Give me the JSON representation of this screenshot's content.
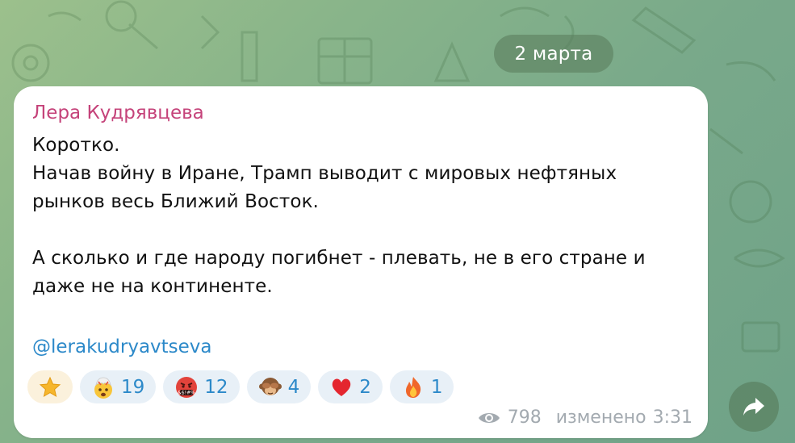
{
  "chat": {
    "date_label": "2 марта"
  },
  "message": {
    "sender": "Лера Кудрявцева",
    "lines": [
      "Коротко.",
      "Начав войну в Иране, Трамп выводит с мировых нефтяных",
      "рынков весь Ближий Восток.",
      "А сколько и где народу погибнет - плевать, не в его стране и",
      "даже не на континенте."
    ],
    "link": "@lerakudryavtseva",
    "reactions": [
      {
        "emoji": "star-icon",
        "count": ""
      },
      {
        "emoji": "exploding-head-icon",
        "count": "19"
      },
      {
        "emoji": "cursing-face-icon",
        "count": "12"
      },
      {
        "emoji": "see-no-evil-monkey-icon",
        "count": "4"
      },
      {
        "emoji": "red-heart-icon",
        "count": "2"
      },
      {
        "emoji": "fire-icon",
        "count": "1"
      }
    ],
    "views": "798",
    "edited_label": "изменено",
    "time": "3:31"
  },
  "colors": {
    "sender": "#c5437a",
    "link": "#2c89c9",
    "meta": "#a3aab0",
    "bubble": "#ffffff"
  }
}
